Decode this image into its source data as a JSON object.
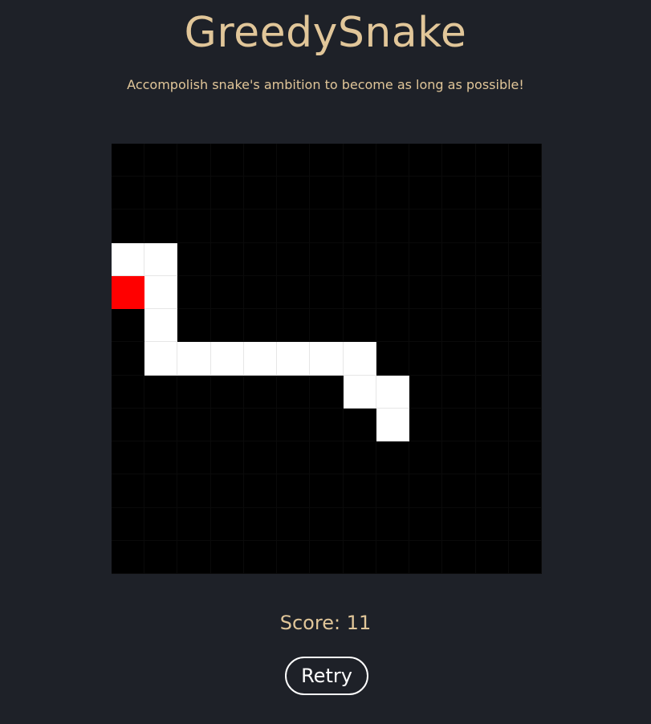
{
  "header": {
    "title": "GreedySnake",
    "subtitle": "Accompolish snake's ambition to become as long as possible!"
  },
  "board": {
    "columns": 13,
    "rows": 13,
    "background_color": "#000000",
    "snake_color": "#ffffff",
    "food_color": "#ff0000",
    "snake": [
      [
        0,
        3
      ],
      [
        1,
        3
      ],
      [
        1,
        4
      ],
      [
        1,
        5
      ],
      [
        1,
        6
      ],
      [
        2,
        6
      ],
      [
        3,
        6
      ],
      [
        4,
        6
      ],
      [
        5,
        6
      ],
      [
        6,
        6
      ],
      [
        7,
        6
      ],
      [
        7,
        7
      ],
      [
        8,
        7
      ],
      [
        8,
        8
      ]
    ],
    "food": [
      0,
      4
    ]
  },
  "score": {
    "text": "Score: 11"
  },
  "controls": {
    "retry_label": "Retry"
  }
}
